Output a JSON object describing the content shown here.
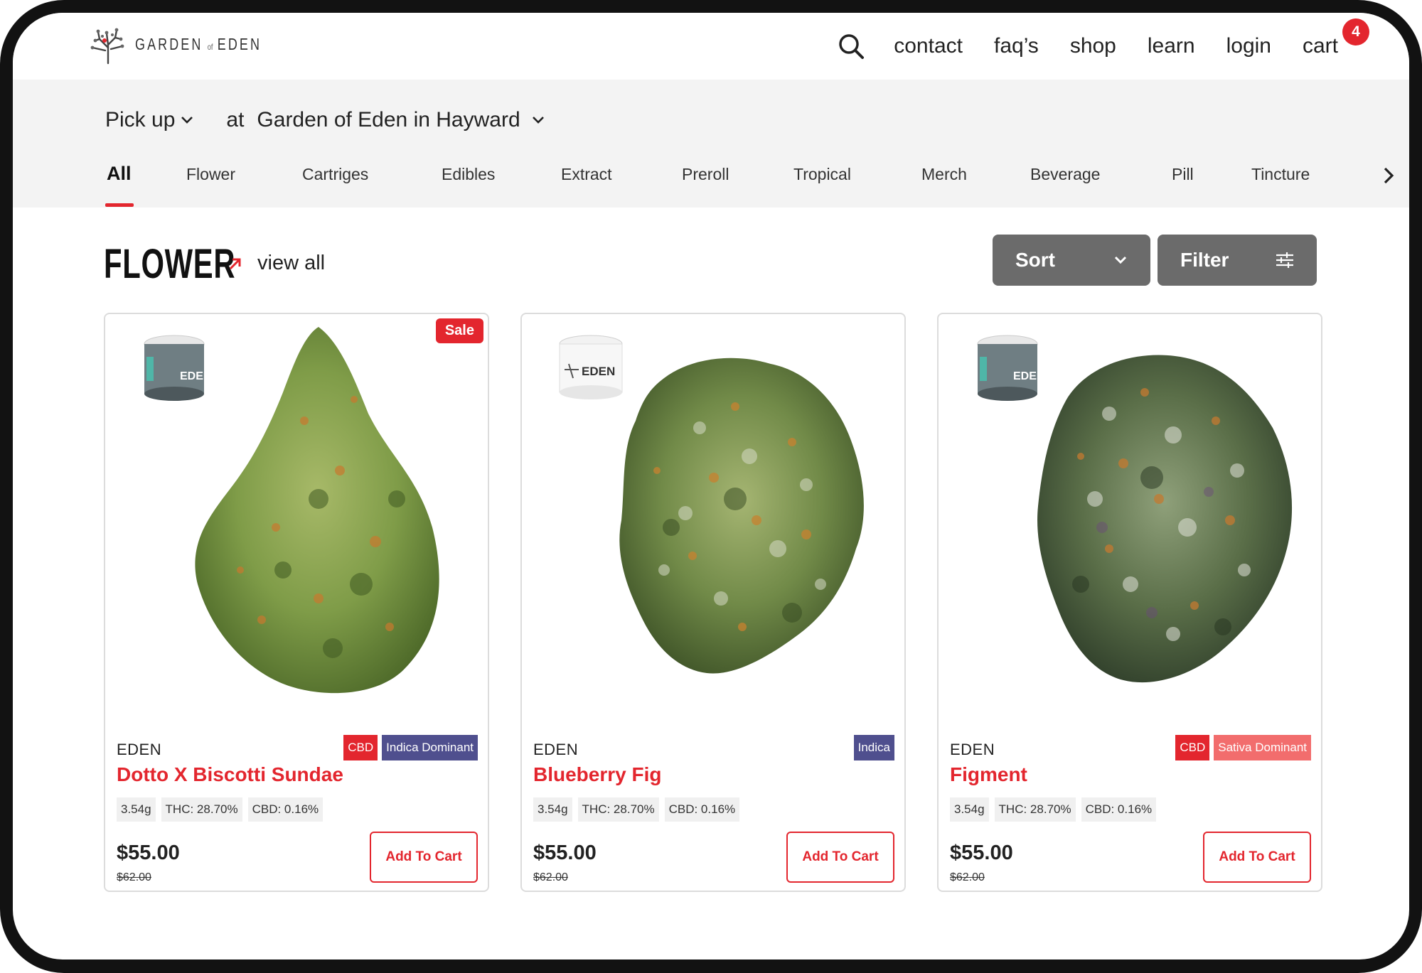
{
  "brand": {
    "name_left": "GARDEN",
    "name_of": "of",
    "name_right": "EDEN"
  },
  "nav": {
    "items": [
      "contact",
      "faq’s",
      "shop",
      "learn",
      "login"
    ],
    "cart_label": "cart",
    "cart_count": "4"
  },
  "pickup": {
    "mode": "Pick up",
    "at": "at",
    "location": "Garden of Eden in Hayward"
  },
  "tabs": [
    "All",
    "Flower",
    "Cartriges",
    "Edibles",
    "Extract",
    "Preroll",
    "Tropical",
    "Merch",
    "Beverage",
    "Pill",
    "Tincture"
  ],
  "active_tab": "All",
  "section": {
    "title": "FLOWER",
    "view_all": "view all"
  },
  "controls": {
    "sort_label": "Sort",
    "filter_label": "Filter"
  },
  "colors": {
    "accent": "#e3262e",
    "indica": "#4f4f8e",
    "sativa": "#f26d6d",
    "button_gray": "#6b6b6b",
    "band": "#f3f3f3"
  },
  "products": [
    {
      "sale": "Sale",
      "brand": "EDEN",
      "name": "Dotto X Biscotti Sundae",
      "tags": [
        "CBD",
        "Indica Dominant"
      ],
      "weight": "3.54g",
      "thc": "THC: 28.70%",
      "cbd": "CBD: 0.16%",
      "price": "$55.00",
      "old_price": "$62.00",
      "button": "Add To Cart"
    },
    {
      "sale": "",
      "brand": "EDEN",
      "name": "Blueberry Fig",
      "tags": [
        "Indica"
      ],
      "weight": "3.54g",
      "thc": "THC: 28.70%",
      "cbd": "CBD: 0.16%",
      "price": "$55.00",
      "old_price": "$62.00",
      "button": "Add To Cart"
    },
    {
      "sale": "",
      "brand": "EDEN",
      "name": "Figment",
      "tags": [
        "CBD",
        "Sativa Dominant"
      ],
      "weight": "3.54g",
      "thc": "THC: 28.70%",
      "cbd": "CBD: 0.16%",
      "price": "$55.00",
      "old_price": "$62.00",
      "button": "Add To Cart"
    }
  ]
}
